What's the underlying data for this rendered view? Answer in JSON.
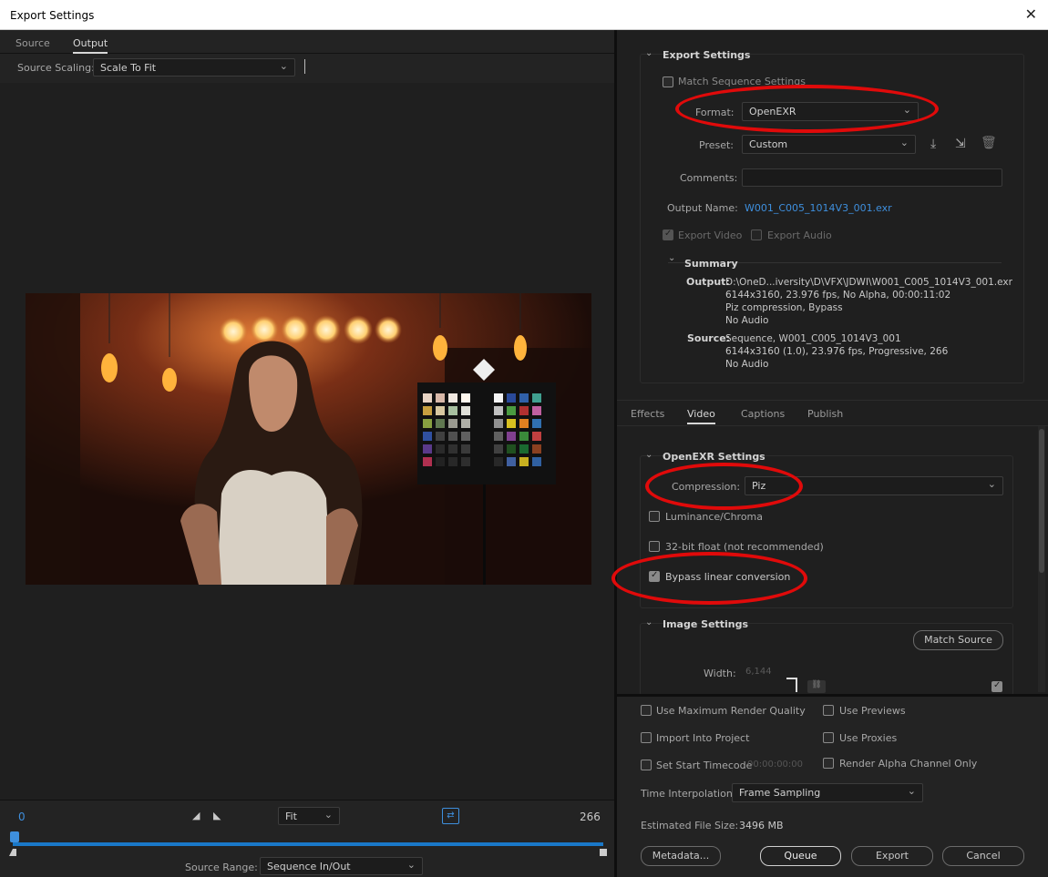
{
  "window": {
    "title": "Export Settings",
    "close_glyph": "✕"
  },
  "left": {
    "tabs": [
      "Source",
      "Output"
    ],
    "source_scaling_label": "Source Scaling:",
    "source_scaling_value": "Scale To Fit",
    "timeline": {
      "start": "0",
      "end": "266",
      "fit_value": "Fit",
      "source_range_label": "Source Range:",
      "source_range_value": "Sequence In/Out"
    }
  },
  "export_settings": {
    "header": "Export Settings",
    "match_sequence": "Match Sequence Settings",
    "format_label": "Format:",
    "format_value": "OpenEXR",
    "preset_label": "Preset:",
    "preset_value": "Custom",
    "comments_label": "Comments:",
    "comments_value": "",
    "output_name_label": "Output Name:",
    "output_name_value": "W001_C005_1014V3_001.exr",
    "export_video": "Export Video",
    "export_audio": "Export Audio",
    "summary": {
      "header": "Summary",
      "output_label": "Output:",
      "output_lines": [
        "D:\\OneD...iversity\\D\\VFX\\JDWI\\W001_C005_1014V3_001.exr",
        "6144x3160, 23.976 fps, No Alpha, 00:00:11:02",
        "Piz compression, Bypass",
        "No Audio"
      ],
      "source_label": "Source:",
      "source_lines": [
        "Sequence, W001_C005_1014V3_001",
        "6144x3160 (1.0), 23.976 fps, Progressive, 266",
        "No Audio"
      ]
    }
  },
  "settings_tabs": [
    "Effects",
    "Video",
    "Captions",
    "Publish"
  ],
  "openexr": {
    "header": "OpenEXR Settings",
    "compression_label": "Compression:",
    "compression_value": "Piz",
    "luminance_chroma": "Luminance/Chroma",
    "float32": "32-bit float (not recommended)",
    "bypass_linear": "Bypass linear conversion"
  },
  "image_settings": {
    "header": "Image Settings",
    "match_source": "Match Source",
    "width_label": "Width:",
    "width_value": "6,144"
  },
  "bottom": {
    "use_max_render_quality": "Use Maximum Render Quality",
    "use_previews": "Use Previews",
    "import_into_project": "Import Into Project",
    "use_proxies": "Use Proxies",
    "set_start_timecode": "Set Start Timecode",
    "start_timecode_value": "00:00:00:00",
    "render_alpha_only": "Render Alpha Channel Only",
    "time_interpolation_label": "Time Interpolation:",
    "time_interpolation_value": "Frame Sampling",
    "estimated_file_size_label": "Estimated File Size:",
    "estimated_file_size_value": "3496 MB",
    "buttons": {
      "metadata": "Metadata...",
      "queue": "Queue",
      "export": "Export",
      "cancel": "Cancel"
    }
  },
  "colors": {
    "link": "#3e8fdd",
    "annotation_red": "#e00a0a",
    "timeline_blue": "#1a78c8"
  }
}
